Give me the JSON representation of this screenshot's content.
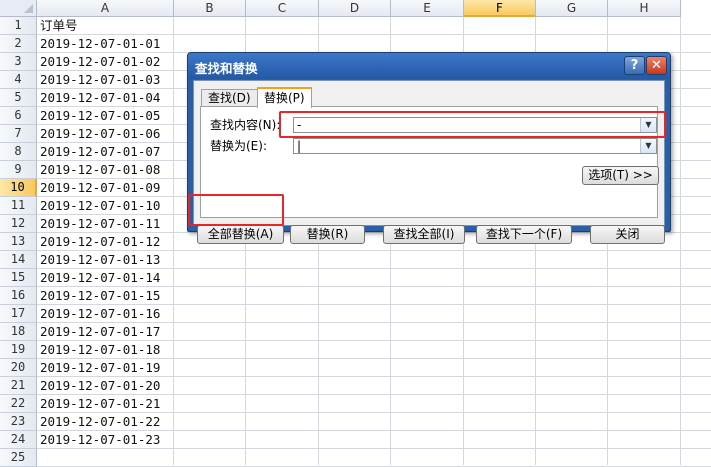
{
  "columns": [
    "A",
    "B",
    "C",
    "D",
    "E",
    "F",
    "G",
    "H"
  ],
  "active_column": "F",
  "rows": [
    "1",
    "2",
    "3",
    "4",
    "5",
    "6",
    "7",
    "8",
    "9",
    "10",
    "11",
    "12",
    "13",
    "14",
    "15",
    "16",
    "17",
    "18",
    "19",
    "20",
    "21",
    "22",
    "23",
    "24",
    "25"
  ],
  "active_row": "10",
  "column_a_values": [
    "订单号",
    "2019-12-07-01-01",
    "2019-12-07-01-02",
    "2019-12-07-01-03",
    "2019-12-07-01-04",
    "2019-12-07-01-05",
    "2019-12-07-01-06",
    "2019-12-07-01-07",
    "2019-12-07-01-08",
    "2019-12-07-01-09",
    "2019-12-07-01-10",
    "2019-12-07-01-11",
    "2019-12-07-01-12",
    "2019-12-07-01-13",
    "2019-12-07-01-14",
    "2019-12-07-01-15",
    "2019-12-07-01-16",
    "2019-12-07-01-17",
    "2019-12-07-01-18",
    "2019-12-07-01-19",
    "2019-12-07-01-20",
    "2019-12-07-01-21",
    "2019-12-07-01-22",
    "2019-12-07-01-23"
  ],
  "dialog": {
    "title": "查找和替换",
    "help_icon": "?",
    "close_icon": "✕",
    "tabs": {
      "find": "查找(D)",
      "replace": "替换(P)"
    },
    "find_label": "查找内容(N):",
    "find_value": "-",
    "replace_label": "替换为(E):",
    "replace_value": "|",
    "options_button": "选项(T) >>",
    "buttons": {
      "replace_all": "全部替换(A)",
      "replace": "替换(R)",
      "find_all": "查找全部(I)",
      "find_next": "查找下一个(F)",
      "close": "关闭"
    }
  },
  "colors": {
    "highlight": "#e8262a",
    "title_bar": "#2a5fa8",
    "active_header": "#f8c95f"
  }
}
